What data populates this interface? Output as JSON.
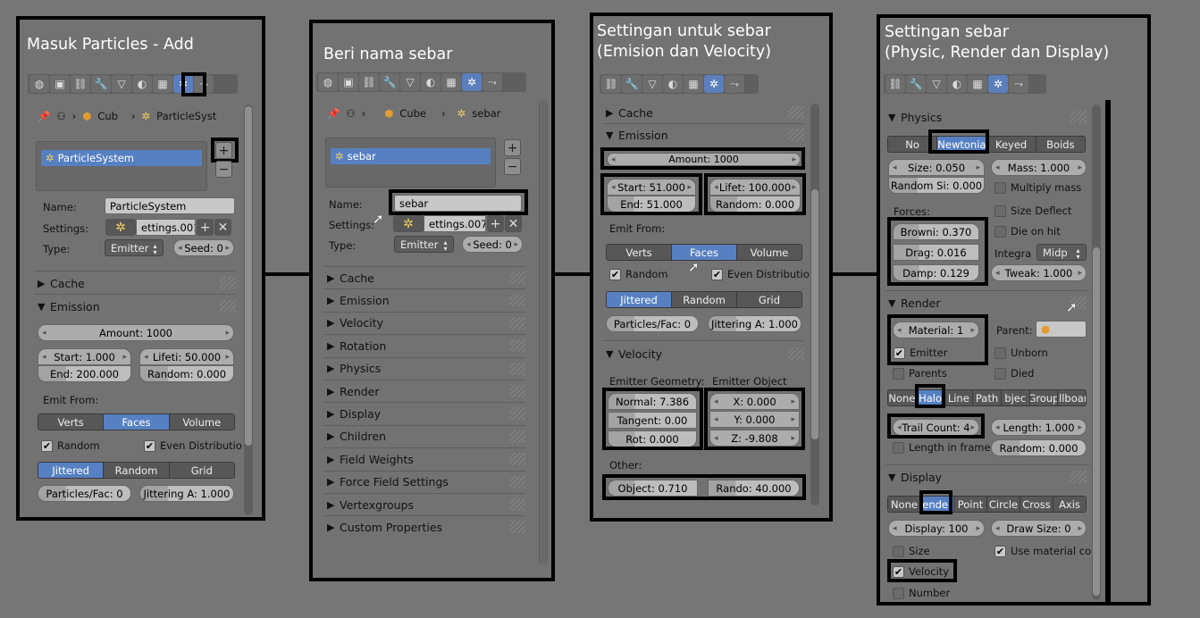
{
  "p1": {
    "title": "Masuk Particles - Add",
    "breadcrumb": {
      "obj": "Cub",
      "sys": "ParticleSyst"
    },
    "list_item": "ParticleSystem",
    "add": "+",
    "remove": "−",
    "name_label": "Name:",
    "name_value": "ParticleSystem",
    "settings_label": "Settings:",
    "settings_value": "ettings.001",
    "type_label": "Type:",
    "type_value": "Emitter",
    "seed": "Seed: 0",
    "cache": "Cache",
    "emission": "Emission",
    "amount": "Amount: 1000",
    "start": "Start: 1.000",
    "lifetime": "Lifeti: 50.000",
    "end": "End: 200.000",
    "random": "Random: 0.000",
    "emit_from": "Emit From:",
    "emit": [
      "Verts",
      "Faces",
      "Volume"
    ],
    "chk_random": "Random",
    "chk_even": "Even Distributio",
    "dist": [
      "Jittered",
      "Random",
      "Grid"
    ],
    "particles_face": "Particles/Fac: 0",
    "jittering": "Jittering A: 1.000"
  },
  "p2": {
    "title": "Beri nama sebar",
    "breadcrumb": {
      "obj": "Cube",
      "sys": "sebar"
    },
    "list_item": "sebar",
    "name_label": "Name:",
    "name_value": "sebar",
    "settings_label": "Settings:",
    "settings_value": "ettings.007",
    "type_label": "Type:",
    "type_value": "Emitter",
    "seed": "Seed: 0",
    "sections": [
      "Cache",
      "Emission",
      "Velocity",
      "Rotation",
      "Physics",
      "Render",
      "Display",
      "Children",
      "Field Weights",
      "Force Field Settings",
      "Vertexgroups",
      "Custom Properties"
    ]
  },
  "p3": {
    "title": "Settingan untuk sebar\n(Emision dan Velocity)",
    "cache": "Cache",
    "emission": "Emission",
    "amount": "Amount: 1000",
    "start": "Start: 51.000",
    "lifetime": "Lifet: 100.000",
    "end": "End: 51.000",
    "random": "Random: 0.000",
    "emit_from": "Emit From:",
    "emit": [
      "Verts",
      "Faces",
      "Volume"
    ],
    "chk_random": "Random",
    "chk_even": "Even Distributio",
    "dist": [
      "Jittered",
      "Random",
      "Grid"
    ],
    "particles_face": "Particles/Fac: 0",
    "jittering": "Jittering A: 1.000",
    "velocity": "Velocity",
    "emitter_geometry": "Emitter Geometry:",
    "emitter_object": "Emitter Object",
    "normal": "Normal: 7.386",
    "tangent": "Tangent: 0.00",
    "rot": "Rot: 0.000",
    "x": "X: 0.000",
    "y": "Y: 0.000",
    "z": "Z: -9.808",
    "other": "Other:",
    "object": "Object: 0.710",
    "rando": "Rando: 40.000"
  },
  "p4": {
    "title": "Settingan sebar\n(Physic, Render dan Display)",
    "physics": "Physics",
    "phys_types": [
      "No",
      "Newtonia",
      "Keyed",
      "Boids"
    ],
    "size": "Size: 0.050",
    "mass": "Mass: 1.000",
    "random_size": "Random Si: 0.000",
    "multiply_mass": "Multiply mass",
    "forces": "Forces:",
    "size_deflect": "Size Deflect",
    "brownian": "Browni: 0.370",
    "die_on_hit": "Die on hit",
    "drag": "Drag: 0.016",
    "integration": "Integra",
    "integ_value": "Midp",
    "damp": "Damp: 0.129",
    "tweak": "Tweak: 1.000",
    "render": "Render",
    "material": "Material: 1",
    "parent": "Parent:",
    "emitter": "Emitter",
    "unborn": "Unborn",
    "parents": "Parents",
    "died": "Died",
    "render_types": [
      "None",
      "Halo",
      "Line",
      "Path",
      "bjec",
      "Group",
      "illboar"
    ],
    "trail_count": "Trail Count: 4",
    "length": "Length: 1.000",
    "length_in_frame": "Length in frame",
    "random2": "Random: 0.000",
    "display": "Display",
    "display_types": [
      "None",
      "ender",
      "Point",
      "Circle",
      "Cross",
      "Axis"
    ],
    "display_amount": "Display: 100",
    "draw_size": "Draw Size: 0",
    "chk_size": "Size",
    "use_material": "Use material co",
    "chk_velocity": "Velocity",
    "chk_number": "Number"
  },
  "icons": {
    "tab_active": "particles-icon"
  },
  "colors": {
    "accent": "#5680c2",
    "frame": "#000000",
    "background": "#767676"
  }
}
